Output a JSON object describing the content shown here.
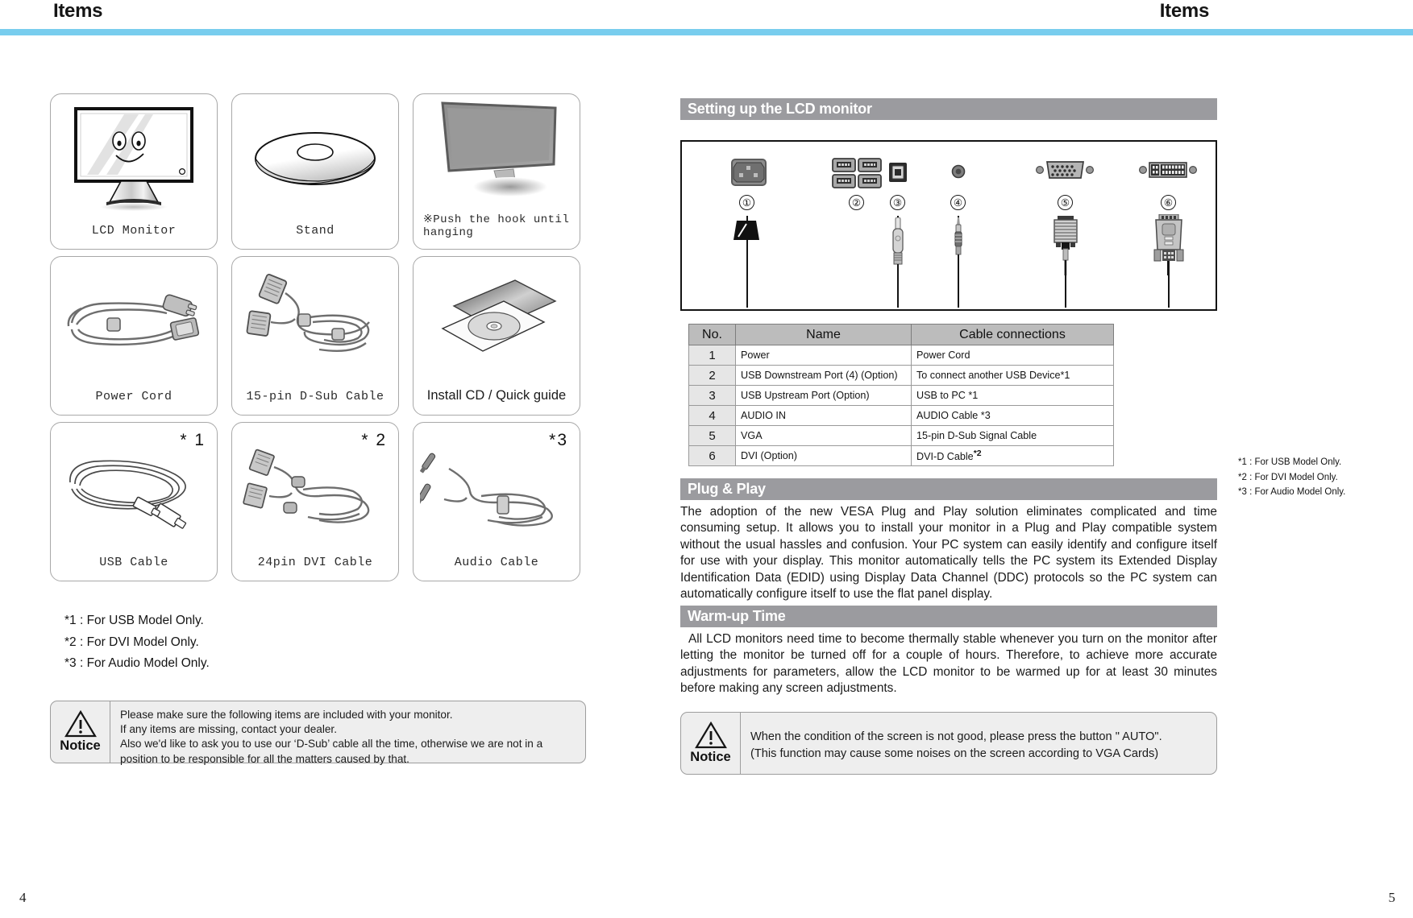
{
  "header": {
    "title_left": "Items",
    "title_right": "Items",
    "rule_color": "#78cdee"
  },
  "pages": {
    "left_number": "4",
    "right_number": "5"
  },
  "left_page": {
    "items": [
      {
        "label": "LCD Monitor",
        "art": "lcd-monitor",
        "star": "",
        "label_style": "mono"
      },
      {
        "label": "Stand",
        "art": "stand-disc",
        "star": "",
        "label_style": "mono"
      },
      {
        "label": "※Push the hook until hanging",
        "art": "monitor-hook",
        "star": "",
        "label_style": "mono-left"
      },
      {
        "label": "Power Cord",
        "art": "power-cord",
        "star": "",
        "label_style": "mono"
      },
      {
        "label": "15-pin D-Sub Cable",
        "art": "dsub-cable",
        "star": "",
        "label_style": "mono"
      },
      {
        "label": "Install CD / Quick guide",
        "art": "install-cd",
        "star": "",
        "label_style": "sans"
      },
      {
        "label": "USB Cable",
        "art": "usb-cable",
        "star": "* 1",
        "label_style": "mono"
      },
      {
        "label": "24pin DVI Cable",
        "art": "dvi-cable",
        "star": "* 2",
        "label_style": "mono"
      },
      {
        "label": "Audio Cable",
        "art": "audio-cable",
        "star": "*3",
        "label_style": "mono"
      }
    ],
    "footnotes": [
      "*1 : For USB Model Only.",
      "*2 : For DVI Model Only.",
      "*3 : For Audio Model Only."
    ],
    "notice": {
      "word": "Notice",
      "line1": "Please make sure the following items are included with your monitor.",
      "line2": "If any items are missing, contact your dealer.",
      "line3": "Also we'd like to ask you to use our ‘D-Sub’ cable all the time, otherwise we are not in a",
      "line4": "position to be responsible for all the matters caused by that."
    }
  },
  "right_page": {
    "sections": {
      "setting_up": "Setting up the LCD monitor",
      "plug_play": "Plug & Play",
      "warm_up": "Warm-up Time"
    },
    "diagram": {
      "callouts": [
        "①",
        "②",
        "③",
        "④",
        "⑤",
        "⑥"
      ],
      "port_names": [
        "power-inlet",
        "usb-downstream-x4",
        "usb-upstream",
        "audio-in-jack",
        "vga-dsub-15",
        "dvi-d-port"
      ],
      "plug_names": [
        "power-plug",
        "usb-b-plug",
        "audio-mini-plug",
        "vga-plug",
        "dvi-plug"
      ]
    },
    "table": {
      "headers": [
        "No.",
        "Name",
        "Cable connections"
      ],
      "rows": [
        {
          "no": "1",
          "name": "Power",
          "conn": "Power Cord",
          "sup": ""
        },
        {
          "no": "2",
          "name": "USB Downstream Port (4) (Option)",
          "conn": "To connect another USB Device*1",
          "sup": ""
        },
        {
          "no": "3",
          "name": "USB Upstream Port (Option)",
          "conn": "USB to PC *1",
          "sup": ""
        },
        {
          "no": "4",
          "name": "AUDIO IN",
          "conn": "AUDIO Cable *3",
          "sup": ""
        },
        {
          "no": "5",
          "name": "VGA",
          "conn": "15-pin D-Sub Signal Cable",
          "sup": ""
        },
        {
          "no": "6",
          "name": "DVI (Option)",
          "conn": "DVI-D Cable",
          "sup": "*2"
        }
      ]
    },
    "footnotes": [
      "*1 : For USB Model Only.",
      "*2 : For DVI Model Only.",
      "*3 : For Audio Model Only."
    ],
    "plug_play_text": "The adoption of the new VESA Plug and Play solution eliminates complicated and time consuming setup. It allows you to install your monitor in a Plug and Play compatible system without the usual hassles and confusion. Your PC system can easily identify and configure itself for use with your display. This monitor automatically tells the PC system its Extended Display Identification Data (EDID) using Display Data Channel (DDC) protocols so the PC system can automatically configure itself to use the flat panel display.",
    "warm_up_text": "All LCD monitors need time to become thermally stable whenever you turn on the monitor after letting the monitor be turned off for a couple of hours. Therefore, to achieve more accurate adjustments for parameters, allow the LCD monitor to be warmed up for at least 30 minutes before making any screen adjustments.",
    "notice": {
      "word": "Notice",
      "line1": "When the condition of the screen is not good, please press the button \" AUTO\".",
      "line2": "(This function may cause some noises on the screen according to VGA Cards)"
    }
  },
  "colors": {
    "section_bar": "#9b9b9f",
    "rule": "#78cdee",
    "table_header": "#bcbcbc",
    "table_no_cell": "#e6e6e6",
    "notice_bg": "#eeeeee"
  }
}
